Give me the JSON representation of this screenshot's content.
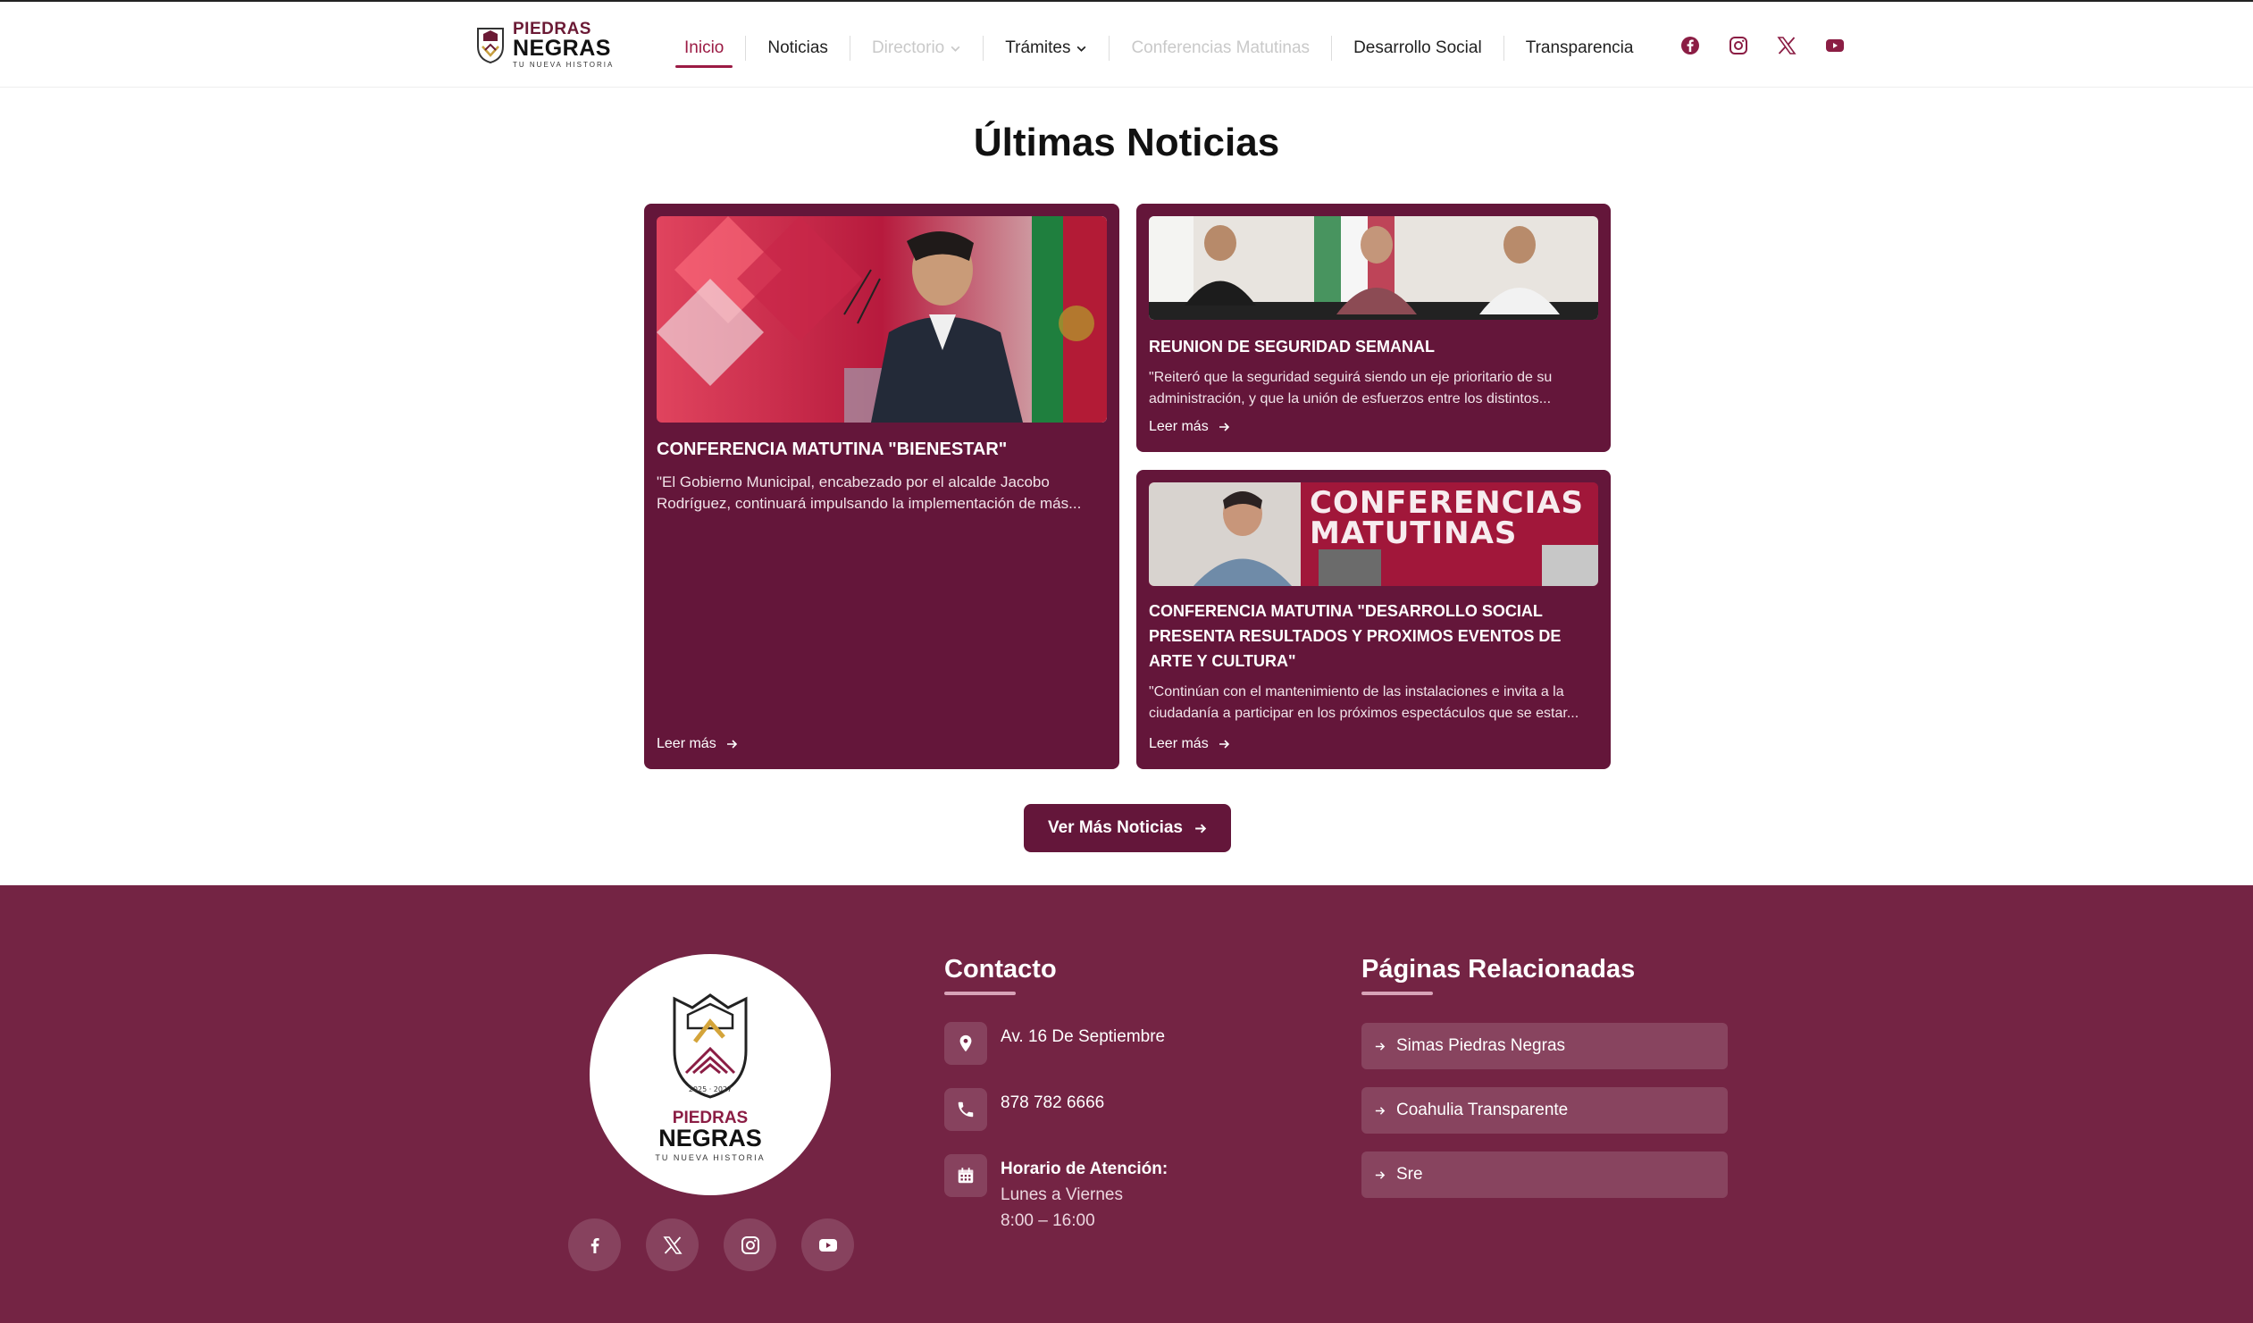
{
  "header": {
    "logo": {
      "top": "PIEDRAS",
      "main": "NEGRAS",
      "sub": "TU NUEVA HISTORIA"
    },
    "nav": [
      {
        "label": "Inicio",
        "state": "active"
      },
      {
        "label": "Noticias",
        "state": "normal"
      },
      {
        "label": "Directorio",
        "state": "disabled",
        "dropdown": true
      },
      {
        "label": "Trámites",
        "state": "normal",
        "dropdown": true
      },
      {
        "label": "Conferencias Matutinas",
        "state": "disabled"
      },
      {
        "label": "Desarrollo Social",
        "state": "normal"
      },
      {
        "label": "Transparencia",
        "state": "normal"
      }
    ],
    "social_icons": [
      "facebook-icon",
      "instagram-icon",
      "x-icon",
      "youtube-icon"
    ]
  },
  "news": {
    "title": "Últimas Noticias",
    "cards": [
      {
        "title": "CONFERENCIA MATUTINA \"BIENESTAR\"",
        "excerpt": "\"El Gobierno Municipal, encabezado por el alcalde Jacobo Rodríguez, continuará impulsando la implementación de más...",
        "more": "Leer más"
      },
      {
        "title": "REUNION DE SEGURIDAD SEMANAL",
        "excerpt": "\"Reiteró que la seguridad seguirá siendo un eje prioritario de su administración, y que la unión de esfuerzos entre los distintos...",
        "more": "Leer más"
      },
      {
        "title": "CONFERENCIA MATUTINA \"DESARROLLO SOCIAL PRESENTA RESULTADOS Y PROXIMOS EVENTOS DE ARTE Y CULTURA\"",
        "excerpt": "\"Continúan con el mantenimiento de las instalaciones e invita a la ciudadanía a participar en los próximos espectáculos que se estar...",
        "more": "Leer más",
        "image_text": "CONFERENCIAS MATUTINAS"
      }
    ],
    "button": "Ver Más Noticias"
  },
  "footer": {
    "logo": {
      "top": "PIEDRAS",
      "main": "NEGRAS",
      "sub": "TU NUEVA HISTORIA",
      "years": "2025 · 2027"
    },
    "contact": {
      "title": "Contacto",
      "address": "Av. 16 De Septiembre",
      "phone": "878 782 6666",
      "hours_label": "Horario de Atención:",
      "hours_days": "Lunes a Viernes",
      "hours_time": "8:00 – 16:00"
    },
    "related": {
      "title": "Páginas Relacionadas",
      "links": [
        "Simas Piedras Negras",
        "Coahulia Transparente",
        "Sre"
      ]
    },
    "social_icons": [
      "facebook-icon",
      "x-icon",
      "instagram-icon",
      "youtube-icon"
    ]
  },
  "colors": {
    "brand": "#64163a",
    "accent": "#9b1b44",
    "footer_bg": "#742444"
  }
}
